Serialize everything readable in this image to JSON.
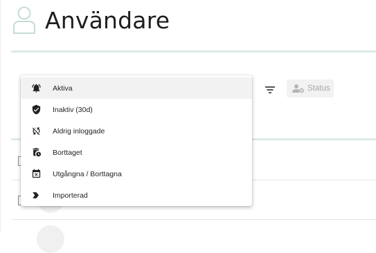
{
  "page": {
    "title": "Användare"
  },
  "toolbar": {
    "status_label": "Status"
  },
  "status_menu": {
    "items": [
      {
        "label": "Aktiva",
        "icon": "bell-icon",
        "selected": true
      },
      {
        "label": "Inaktiv (30d)",
        "icon": "shield-check-icon",
        "selected": false
      },
      {
        "label": "Aldrig inloggade",
        "icon": "sync-disabled-icon",
        "selected": false
      },
      {
        "label": "Borttaget",
        "icon": "delete-clock-icon",
        "selected": false
      },
      {
        "label": "Utgångna / Borttagna",
        "icon": "event-busy-icon",
        "selected": false
      },
      {
        "label": "Importerad",
        "icon": "label-important-icon",
        "selected": false
      }
    ]
  },
  "colors": {
    "accent_line": "#dcebe6",
    "user_icon": "#c5dcd4",
    "menu_hover": "#f2f2f2"
  }
}
